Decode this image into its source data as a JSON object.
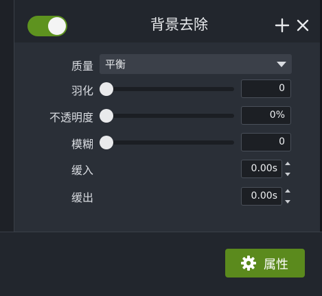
{
  "header": {
    "title": "背景去除",
    "enabled": true,
    "toggle_color": "#5e931f",
    "icons": {
      "add": "plus-icon",
      "close": "close-icon"
    }
  },
  "properties": {
    "quality": {
      "label": "质量",
      "value": "平衡"
    },
    "feather": {
      "label": "羽化",
      "value": "0",
      "level": 0
    },
    "opacity": {
      "label": "不透明度",
      "value": "0%",
      "level": 0
    },
    "blur": {
      "label": "模糊",
      "value": "0",
      "level": 0
    },
    "ease_in": {
      "label": "缓入",
      "value": "0.00s"
    },
    "ease_out": {
      "label": "缓出",
      "value": "0.00s"
    }
  },
  "footer": {
    "properties_button": "属性",
    "properties_icon": "gear-icon",
    "accent": "#5b8a1d"
  }
}
